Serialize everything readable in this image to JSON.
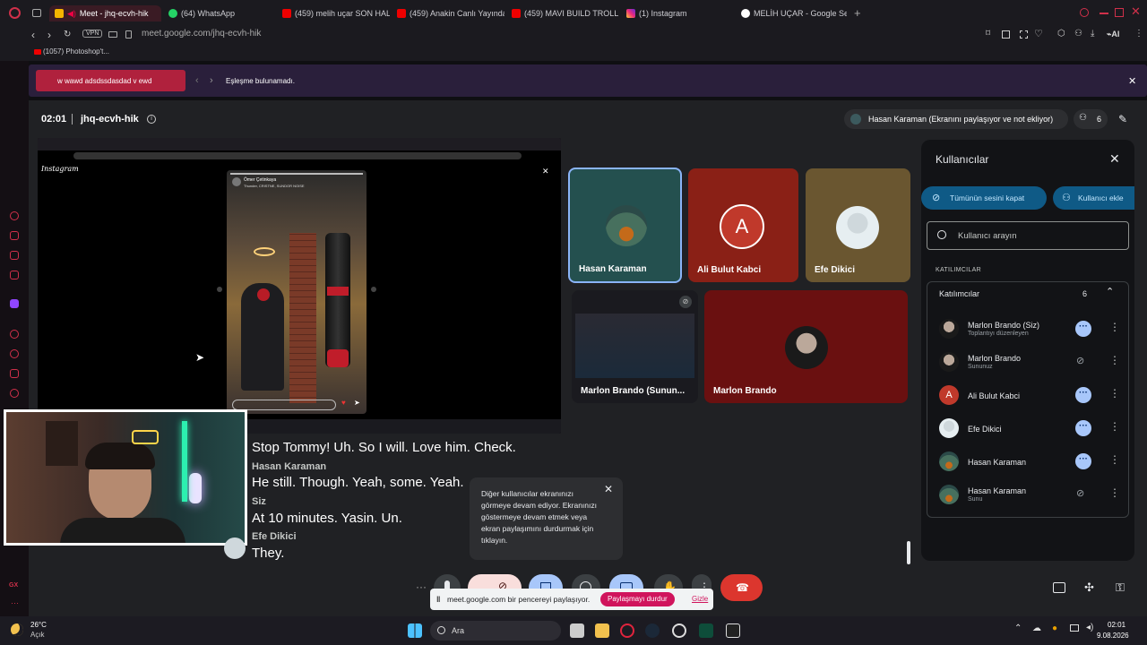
{
  "browser": {
    "tabs": [
      {
        "label": "Meet - jhq-ecvh-hik",
        "active": true
      },
      {
        "label": "(64) WhatsApp"
      },
      {
        "label": "(459) melih uçar SON HAL"
      },
      {
        "label": "(459) Anakin Canlı Yayında"
      },
      {
        "label": "(459) MAVI BUILD TROLL"
      },
      {
        "label": "(1) Instagram"
      },
      {
        "label": "MELİH UÇAR - Google Sea"
      }
    ],
    "url": "meet.google.com/jhq-ecvh-hik",
    "vpn_label": "VPN",
    "ai_label": "AI",
    "bookmark": "(1057) Photoshop't...",
    "new_tab_icon": "plus-icon"
  },
  "findbar": {
    "query": "w wawd adsdssdasdad v   ewd",
    "result": "Eşleşme bulunamadı."
  },
  "meet": {
    "time": "02:01",
    "meeting_code": "jhq-ecvh-hik",
    "presenter_banner": "Hasan Karaman (Ekranını paylaşıyor ve not ekliyor)",
    "participant_count": "6",
    "shared_screen": {
      "brand": "Instagram",
      "post_user": "Ömer Çetinkaya",
      "post_sub": "Thunder, CRISTNE, SUNDOR NOISE"
    },
    "tiles": [
      {
        "name": "Hasan Karaman"
      },
      {
        "name": "Ali Bulut Kabci",
        "initial": "A"
      },
      {
        "name": "Efe Dikici"
      },
      {
        "name": "Marlon Brando (Sunun..."
      },
      {
        "name": "Marlon Brando"
      }
    ],
    "captions": [
      {
        "text": "Stop Tommy! Uh. So I will. Love him. Check."
      },
      {
        "speaker": "Hasan Karaman",
        "text": "He still. Though. Yeah, some. Yeah."
      },
      {
        "speaker": "Siz",
        "text": "At 10 minutes. Yasin. Un."
      },
      {
        "speaker": "Efe Dikici",
        "text": "They."
      }
    ],
    "toast": "Diğer kullanıcılar ekranınızı görmeye devam ediyor. Ekranınızı göstermeye devam etmek veya ekran paylaşımını durdurmak için tıklayın.",
    "share_bar": {
      "text": "meet.google.com bir pencereyi paylaşıyor.",
      "stop": "Paylaşmayı durdur",
      "hide": "Gizle"
    },
    "people_panel": {
      "title": "Kullanıcılar",
      "mute_all": "Tümünün sesini kapat",
      "add_user": "Kullanıcı ekle",
      "search_placeholder": "Kullanıcı arayın",
      "section_label": "KATILIMCILAR",
      "group_label": "Katılımcılar",
      "group_count": "6",
      "participants": [
        {
          "name": "Marlon Brando (Siz)",
          "sub": "Toplantıyı düzenleyen",
          "state": "speaking"
        },
        {
          "name": "Marlon Brando",
          "sub": "Sununuz",
          "state": "muted"
        },
        {
          "name": "Ali Bulut Kabci",
          "initial": "A",
          "state": "speaking"
        },
        {
          "name": "Efe Dikici",
          "state": "speaking"
        },
        {
          "name": "Hasan Karaman",
          "state": "speaking"
        },
        {
          "name": "Hasan Karaman",
          "sub": "Sunu",
          "state": "muted"
        }
      ]
    }
  },
  "taskbar": {
    "weather_temp": "26°C",
    "weather_desc": "Açık",
    "search": "Ara",
    "clock_time": "02:01",
    "clock_date": "9.08.2026"
  },
  "colors": {
    "accent": "#d0304a",
    "meet_bg": "#202124",
    "panel_bg": "#121316",
    "highlight": "#a8c7fa",
    "end_call": "#dc362e"
  }
}
